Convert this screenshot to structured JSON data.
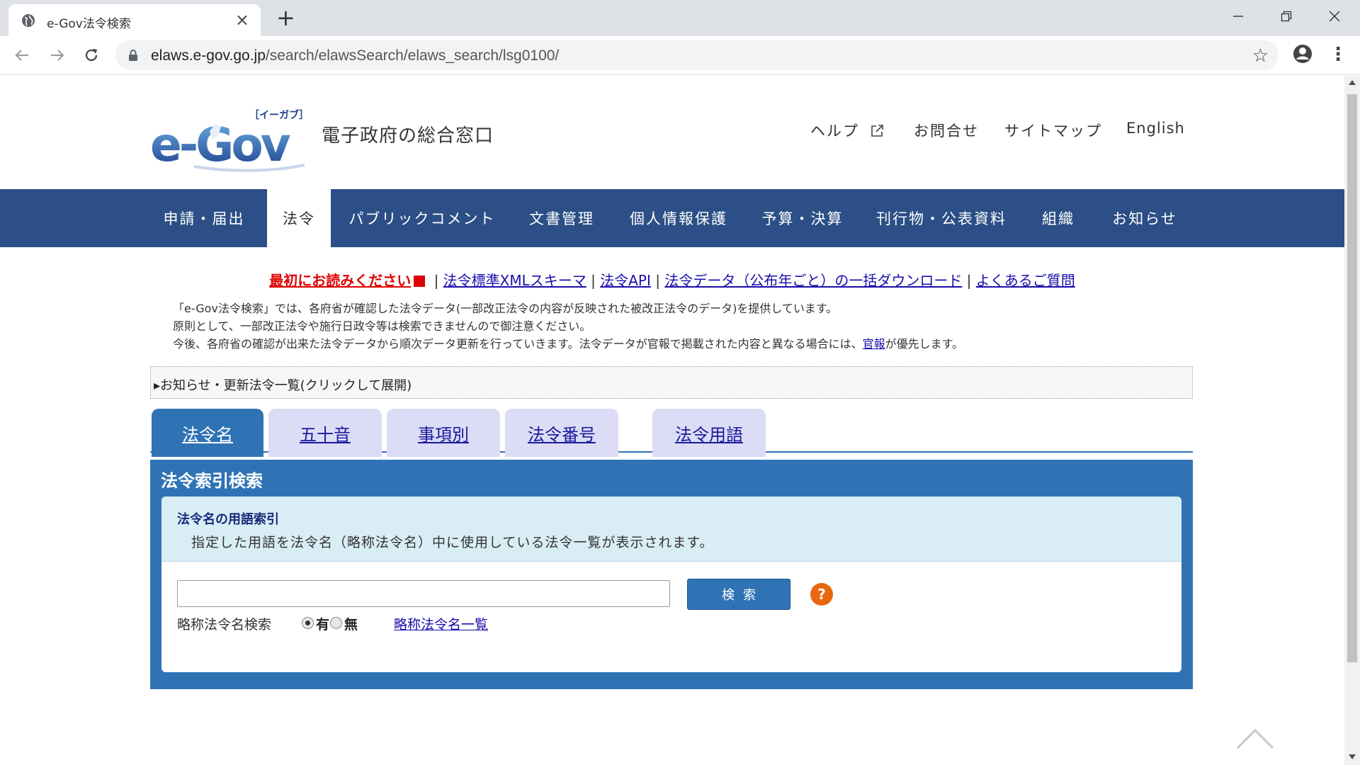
{
  "browser": {
    "tab_title": "e-Gov法令検索",
    "tab_close": "×",
    "new_tab": "+",
    "url_host": "elaws.e-gov.go.jp",
    "url_path": "/search/elawsSearch/elaws_search/lsg0100/",
    "star": "☆",
    "menu": "⋮"
  },
  "header": {
    "logo_text": "e-Gov",
    "logo_kana": "［イーガブ］",
    "tagline": "電子政府の総合窓口",
    "links": {
      "help": "ヘルプ",
      "contact": "お問合せ",
      "sitemap": "サイトマップ",
      "english": "English"
    }
  },
  "mainnav": {
    "items": [
      "申請・届出",
      "法令",
      "パブリックコメント",
      "文書管理",
      "個人情報保護",
      "予算・決算",
      "刊行物・公表資料",
      "組織",
      "お知らせ"
    ]
  },
  "toplinks": {
    "first": "最初にお読みください",
    "sep": " | ",
    "xml_schema": "法令標準XMLスキーマ",
    "api": "法令API",
    "bulk_download": "法令データ（公布年ごと）の一括ダウンロード",
    "faq": "よくあるご質問"
  },
  "intro": {
    "line1": "「e-Gov法令検索」では、各府省が確認した法令データ(一部改正法令の内容が反映された被改正法令のデータ)を提供しています。",
    "line2": "原則として、一部改正法令や施行日政令等は検索できませんので御注意ください。",
    "line3_a": "今後、各府省の確認が出来た法令データから順次データ更新を行っていきます。法令データが官報で掲載された内容と異なる場合には、",
    "line3_link": "官報",
    "line3_b": "が優先します。"
  },
  "notice_bar": "▸お知らせ・更新法令一覧(クリックして展開)",
  "search_tabs": [
    "法令名",
    "五十音",
    "事項別",
    "法令番号",
    "法令用語"
  ],
  "search_panel": {
    "title": "法令索引検索",
    "desc_title": "法令名の用語索引",
    "desc_text": "指定した用語を法令名（略称法令名）中に使用している法令一覧が表示されます。",
    "input_value": "",
    "button": "検索",
    "help": "?",
    "abbrev_label": "略称法令名検索",
    "radio_yes": "有",
    "radio_no": "無",
    "radio_selected": "有",
    "abbrev_link": "略称法令名一覧"
  },
  "colors": {
    "nav_bg": "#2b4f86",
    "panel_blue": "#2f73b5",
    "tab_inactive": "#dcdcf6",
    "desc_bg": "#d9edf5",
    "help_orange": "#e8680f",
    "warn_red": "#e00000"
  }
}
